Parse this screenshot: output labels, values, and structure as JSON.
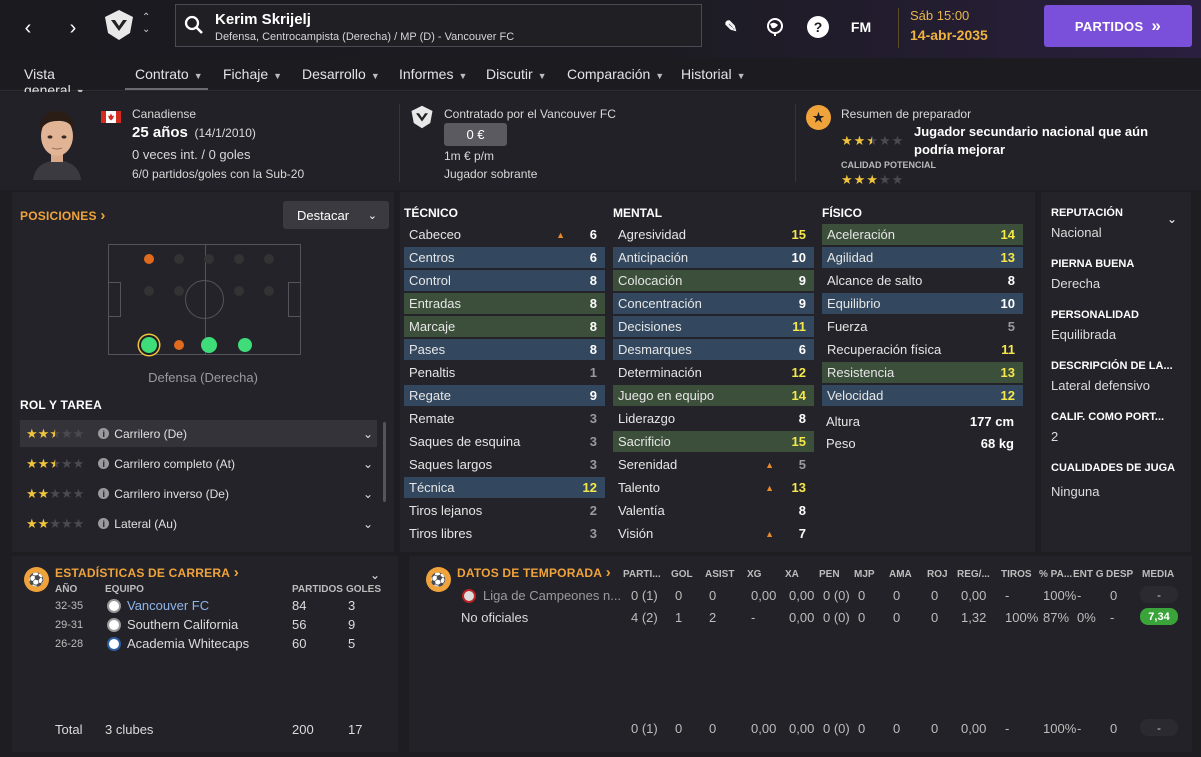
{
  "topbar": {
    "player_name": "Kerim Skrijelj",
    "player_subtitle": "Defensa, Centrocampista (Derecha) / MP (D) - Vancouver FC",
    "fm_label": "FM",
    "help_label": "?",
    "date_time": "Sáb 15:00",
    "date_full": "14-abr-2035",
    "partidos_label": "PARTIDOS",
    "partidos_chevrons": "»"
  },
  "menu": [
    {
      "label": "Vista general"
    },
    {
      "label": "Contrato"
    },
    {
      "label": "Fichaje"
    },
    {
      "label": "Desarrollo"
    },
    {
      "label": "Informes"
    },
    {
      "label": "Discutir"
    },
    {
      "label": "Comparación"
    },
    {
      "label": "Historial"
    }
  ],
  "header": {
    "nationality": "Canadiense",
    "age": "25 años",
    "birth": "(14/1/2010)",
    "caps": "0 veces int. / 0 goles",
    "u20": "6/0 partidos/goles con la Sub-20",
    "contracted_by": "Contratado por el Vancouver FC",
    "salary": "0 €",
    "value": "1m € p/m",
    "squad_status": "Jugador sobrante",
    "coach_summary_label": "Resumen de preparador",
    "coach_summary": "Jugador secundario nacional que aún podría mejorar",
    "potential_label": "CALIDAD POTENCIAL",
    "current_stars": 2.5,
    "potential_stars": 3
  },
  "positions": {
    "title": "POSICIONES",
    "title_chevron": "›",
    "highlight_button": "Destacar",
    "position_label": "Defensa (Derecha)",
    "role_title": "ROL Y TAREA",
    "roles": [
      {
        "name": "Carrilero (De)",
        "stars": 2.5
      },
      {
        "name": "Carrilero completo (At)",
        "stars": 2.5
      },
      {
        "name": "Carrilero inverso (De)",
        "stars": 2
      },
      {
        "name": "Lateral (Au)",
        "stars": 2
      }
    ]
  },
  "attributes": {
    "tecnico_title": "TÉCNICO",
    "mental_title": "MENTAL",
    "fisico_title": "FÍSICO",
    "tecnico": [
      {
        "name": "Cabeceo",
        "value": "6",
        "hl": "",
        "trend": "up"
      },
      {
        "name": "Centros",
        "value": "6",
        "hl": "blue",
        "trend": ""
      },
      {
        "name": "Control",
        "value": "8",
        "hl": "blue",
        "trend": ""
      },
      {
        "name": "Entradas",
        "value": "8",
        "hl": "green",
        "trend": ""
      },
      {
        "name": "Marcaje",
        "value": "8",
        "hl": "green",
        "trend": ""
      },
      {
        "name": "Pases",
        "value": "8",
        "hl": "blue",
        "trend": ""
      },
      {
        "name": "Penaltis",
        "value": "1",
        "hl": "",
        "trend": ""
      },
      {
        "name": "Regate",
        "value": "9",
        "hl": "blue",
        "trend": ""
      },
      {
        "name": "Remate",
        "value": "3",
        "hl": "",
        "trend": ""
      },
      {
        "name": "Saques de esquina",
        "value": "3",
        "hl": "",
        "trend": ""
      },
      {
        "name": "Saques largos",
        "value": "3",
        "hl": "",
        "trend": ""
      },
      {
        "name": "Técnica",
        "value": "12",
        "hl": "blue",
        "trend": ""
      },
      {
        "name": "Tiros lejanos",
        "value": "2",
        "hl": "",
        "trend": ""
      },
      {
        "name": "Tiros libres",
        "value": "3",
        "hl": "",
        "trend": ""
      }
    ],
    "mental": [
      {
        "name": "Agresividad",
        "value": "15",
        "hl": "",
        "trend": ""
      },
      {
        "name": "Anticipación",
        "value": "10",
        "hl": "blue",
        "trend": ""
      },
      {
        "name": "Colocación",
        "value": "9",
        "hl": "green",
        "trend": ""
      },
      {
        "name": "Concentración",
        "value": "9",
        "hl": "blue",
        "trend": ""
      },
      {
        "name": "Decisiones",
        "value": "11",
        "hl": "blue",
        "trend": ""
      },
      {
        "name": "Desmarques",
        "value": "6",
        "hl": "blue",
        "trend": ""
      },
      {
        "name": "Determinación",
        "value": "12",
        "hl": "",
        "trend": ""
      },
      {
        "name": "Juego en equipo",
        "value": "14",
        "hl": "green",
        "trend": ""
      },
      {
        "name": "Liderazgo",
        "value": "8",
        "hl": "",
        "trend": ""
      },
      {
        "name": "Sacrificio",
        "value": "15",
        "hl": "green",
        "trend": ""
      },
      {
        "name": "Serenidad",
        "value": "5",
        "hl": "",
        "trend": "up"
      },
      {
        "name": "Talento",
        "value": "13",
        "hl": "",
        "trend": "up"
      },
      {
        "name": "Valentía",
        "value": "8",
        "hl": "",
        "trend": ""
      },
      {
        "name": "Visión",
        "value": "7",
        "hl": "",
        "trend": "up"
      }
    ],
    "fisico": [
      {
        "name": "Aceleración",
        "value": "14",
        "hl": "green",
        "trend": ""
      },
      {
        "name": "Agilidad",
        "value": "13",
        "hl": "blue",
        "trend": ""
      },
      {
        "name": "Alcance de salto",
        "value": "8",
        "hl": "",
        "trend": ""
      },
      {
        "name": "Equilibrio",
        "value": "10",
        "hl": "blue",
        "trend": ""
      },
      {
        "name": "Fuerza",
        "value": "5",
        "hl": "",
        "trend": ""
      },
      {
        "name": "Recuperación física",
        "value": "11",
        "hl": "",
        "trend": ""
      },
      {
        "name": "Resistencia",
        "value": "13",
        "hl": "green",
        "trend": ""
      },
      {
        "name": "Velocidad",
        "value": "12",
        "hl": "blue",
        "trend": ""
      }
    ],
    "height_label": "Altura",
    "height": "177 cm",
    "weight_label": "Peso",
    "weight": "68 kg"
  },
  "info": {
    "reputation_label": "REPUTACIÓN",
    "reputation": "Nacional",
    "foot_label": "PIERNA BUENA",
    "foot": "Derecha",
    "personality_label": "PERSONALIDAD",
    "personality": "Equilibrada",
    "media_label": "DESCRIPCIÓN DE LA...",
    "media": "Lateral defensivo",
    "gk_label": "CALIF. COMO PORT...",
    "gk": "2",
    "traits_label": "CUALIDADES DE JUGA",
    "traits": "Ninguna"
  },
  "career": {
    "title": "ESTADÍSTICAS DE CARRERA",
    "title_chevron": "›",
    "headers": [
      "AÑO",
      "EQUIPO",
      "PARTIDOS",
      "GOLES"
    ],
    "rows": [
      {
        "year": "32-35",
        "team": "Vancouver FC",
        "apps": "84",
        "goals": "3"
      },
      {
        "year": "29-31",
        "team": "Southern California",
        "apps": "56",
        "goals": "9"
      },
      {
        "year": "26-28",
        "team": "Academia Whitecaps",
        "apps": "60",
        "goals": "5"
      }
    ],
    "total_label": "Total",
    "total_clubs": "3 clubes",
    "total_apps": "200",
    "total_goals": "17"
  },
  "season": {
    "title": "DATOS DE TEMPORADA",
    "title_chevron": "›",
    "headers": [
      "PARTI...",
      "GOL",
      "ASIST",
      "XG",
      "XA",
      "PEN",
      "MJP",
      "AMA",
      "ROJ",
      "REG/...",
      "TIROS",
      "% PA...",
      "ENT G",
      "DESP",
      "MEDIA"
    ],
    "rows": [
      {
        "comp": "Liga de Campeones n...",
        "cells": [
          "0 (1)",
          "0",
          "0",
          "0,00",
          "0,00",
          "0 (0)",
          "0",
          "0",
          "0",
          "0,00",
          "-",
          "100%",
          "-",
          "0",
          "-"
        ]
      },
      {
        "comp": "No oficiales",
        "cells": [
          "4 (2)",
          "1",
          "2",
          "-",
          "0,00",
          "0 (0)",
          "0",
          "0",
          "0",
          "1,32",
          "100%",
          "87%",
          "0%",
          "-",
          "7,34"
        ]
      }
    ],
    "total_cells": [
      "0 (1)",
      "0",
      "0",
      "0,00",
      "0,00",
      "0 (0)",
      "0",
      "0",
      "0",
      "0,00",
      "-",
      "100%",
      "-",
      "0",
      "-"
    ]
  }
}
